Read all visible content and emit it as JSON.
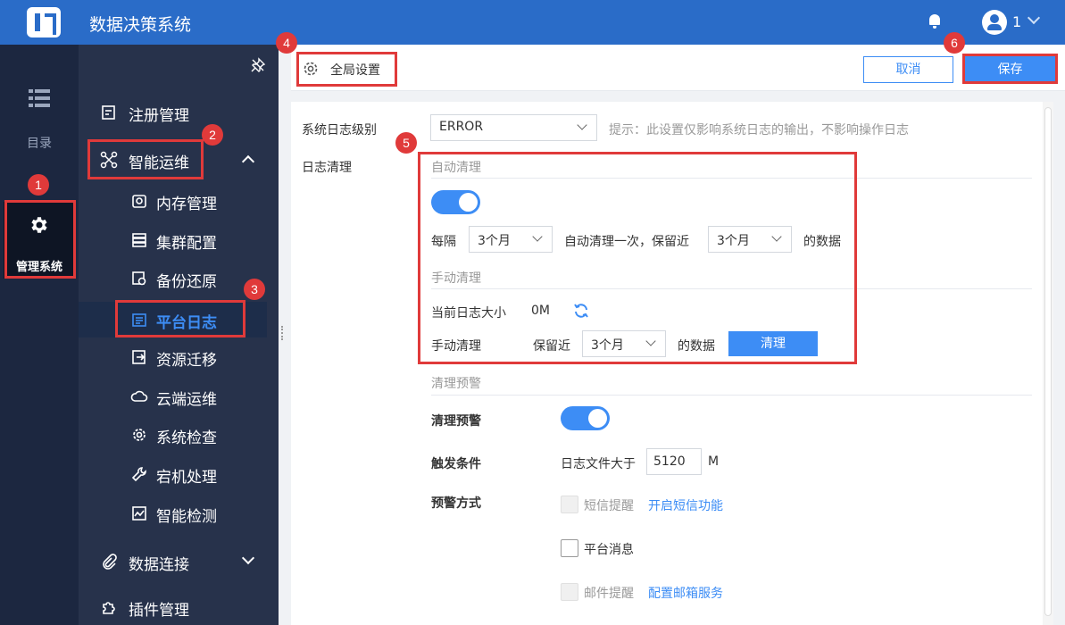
{
  "app": {
    "title": "数据决策系统",
    "user": "1"
  },
  "rail": {
    "directory_label": "目录",
    "admin_label": "管理系统"
  },
  "sidebar": {
    "items": [
      {
        "label": "注册管理"
      },
      {
        "label": "智能运维"
      },
      {
        "label": "内存管理"
      },
      {
        "label": "集群配置"
      },
      {
        "label": "备份还原"
      },
      {
        "label": "平台日志"
      },
      {
        "label": "资源迁移"
      },
      {
        "label": "云端运维"
      },
      {
        "label": "系统检查"
      },
      {
        "label": "宕机处理"
      },
      {
        "label": "智能检测"
      },
      {
        "label": "数据连接"
      },
      {
        "label": "插件管理"
      }
    ],
    "active": "平台日志"
  },
  "toolbar": {
    "tab_label": "全局设置",
    "cancel_label": "取消",
    "save_label": "保存"
  },
  "form": {
    "log_level_label": "系统日志级别",
    "log_level_value": "ERROR",
    "log_level_hint": "提示：此设置仅影响系统日志的输出，不影响操作日志",
    "log_cleanup_label": "日志清理",
    "auto_section": "自动清理",
    "every_label": "每隔",
    "interval_value": "3个月",
    "auto_mid": "自动清理一次，保留近",
    "keep_value": "3个月",
    "data_suffix": "的数据",
    "manual_section": "手动清理",
    "current_size_label": "当前日志大小",
    "current_size_value": "0M",
    "manual_label": "手动清理",
    "keep_recent_label": "保留近",
    "manual_keep_value": "3个月",
    "manual_data_suffix": "的数据",
    "clean_button": "清理",
    "warn_section": "清理预警",
    "warn_toggle_label": "清理预警",
    "trigger_label": "触发条件",
    "trigger_text": "日志文件大于",
    "trigger_value": "5120",
    "trigger_unit": "M",
    "method_label": "预警方式",
    "sms_label": "短信提醒",
    "sms_link": "开启短信功能",
    "platform_label": "平台消息",
    "mail_label": "邮件提醒",
    "mail_link": "配置邮箱服务"
  },
  "markers": [
    "1",
    "2",
    "3",
    "4",
    "5",
    "6"
  ],
  "colors": {
    "accent": "#3d8df5",
    "topbar": "#2a6cc8",
    "sidebar": "#27324b",
    "highlight": "#e03a3a"
  },
  "toggles": {
    "auto_cleanup": true,
    "cleanup_warning": true
  },
  "checkboxes": {
    "sms": false,
    "platform": false,
    "mail": false
  }
}
